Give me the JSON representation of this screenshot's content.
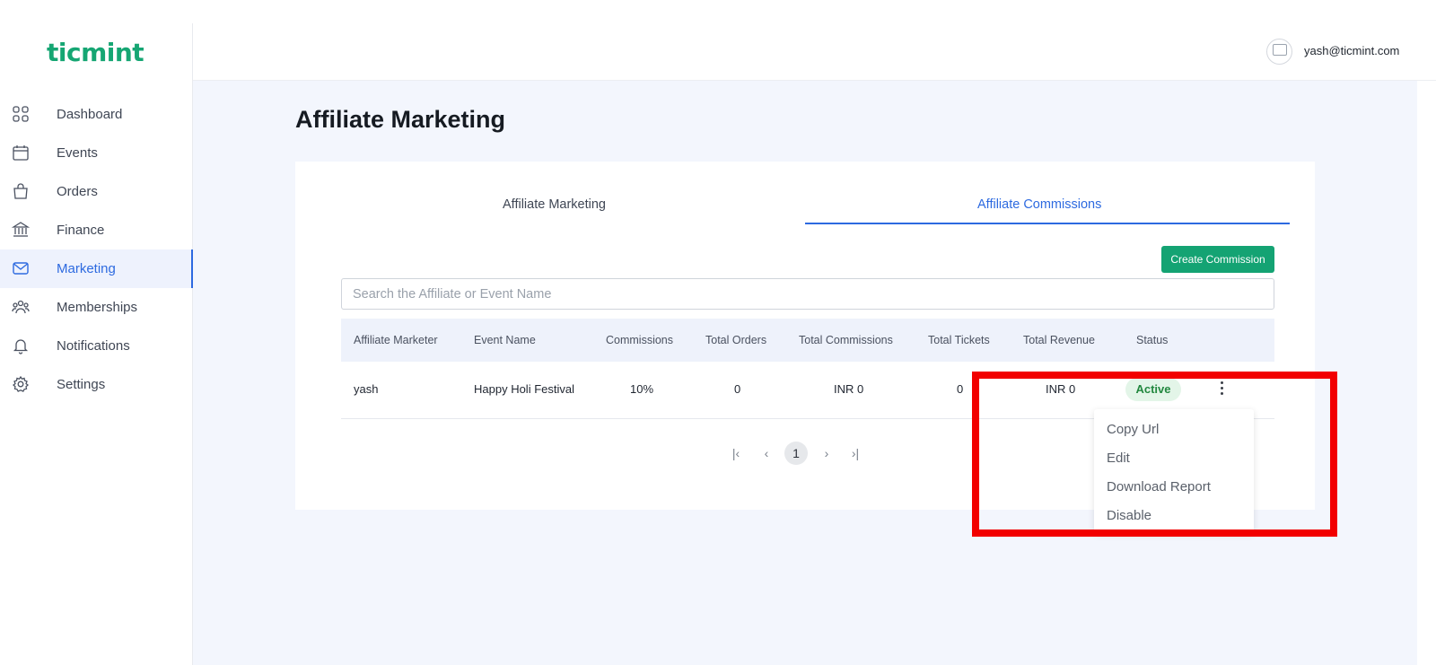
{
  "brand": {
    "logo": "ticmint"
  },
  "sidebar": {
    "items": [
      {
        "label": "Dashboard",
        "icon": "grid-icon"
      },
      {
        "label": "Events",
        "icon": "calendar-icon"
      },
      {
        "label": "Orders",
        "icon": "bag-icon"
      },
      {
        "label": "Finance",
        "icon": "bank-icon"
      },
      {
        "label": "Marketing",
        "icon": "mail-icon",
        "active": true
      },
      {
        "label": "Memberships",
        "icon": "users-icon"
      },
      {
        "label": "Notifications",
        "icon": "bell-icon"
      },
      {
        "label": "Settings",
        "icon": "gear-icon"
      }
    ]
  },
  "header": {
    "user_email": "yash@ticmint.com"
  },
  "page": {
    "title": "Affiliate Marketing"
  },
  "tabs": [
    {
      "label": "Affiliate Marketing",
      "active": false
    },
    {
      "label": "Affiliate Commissions",
      "active": true
    }
  ],
  "toolbar": {
    "create_label": "Create Commission"
  },
  "search": {
    "placeholder": "Search the Affiliate or Event Name",
    "value": ""
  },
  "table": {
    "columns": [
      "Affiliate Marketer",
      "Event Name",
      "Commissions",
      "Total Orders",
      "Total Commissions",
      "Total Tickets",
      "Total Revenue",
      "Status"
    ],
    "rows": [
      {
        "affiliate": "yash",
        "event": "Happy Holi Festival",
        "commission": "10%",
        "orders": "0",
        "total_commissions": "INR 0",
        "tickets": "0",
        "revenue": "INR 0",
        "status": "Active"
      }
    ]
  },
  "pagination": {
    "current": "1"
  },
  "menu": {
    "items": [
      "Copy Url",
      "Edit",
      "Download Report",
      "Disable"
    ]
  },
  "colors": {
    "brand": "#16a673",
    "accent": "#2d6ae0",
    "annotation": "#f20000",
    "status_active": "#22883f"
  }
}
